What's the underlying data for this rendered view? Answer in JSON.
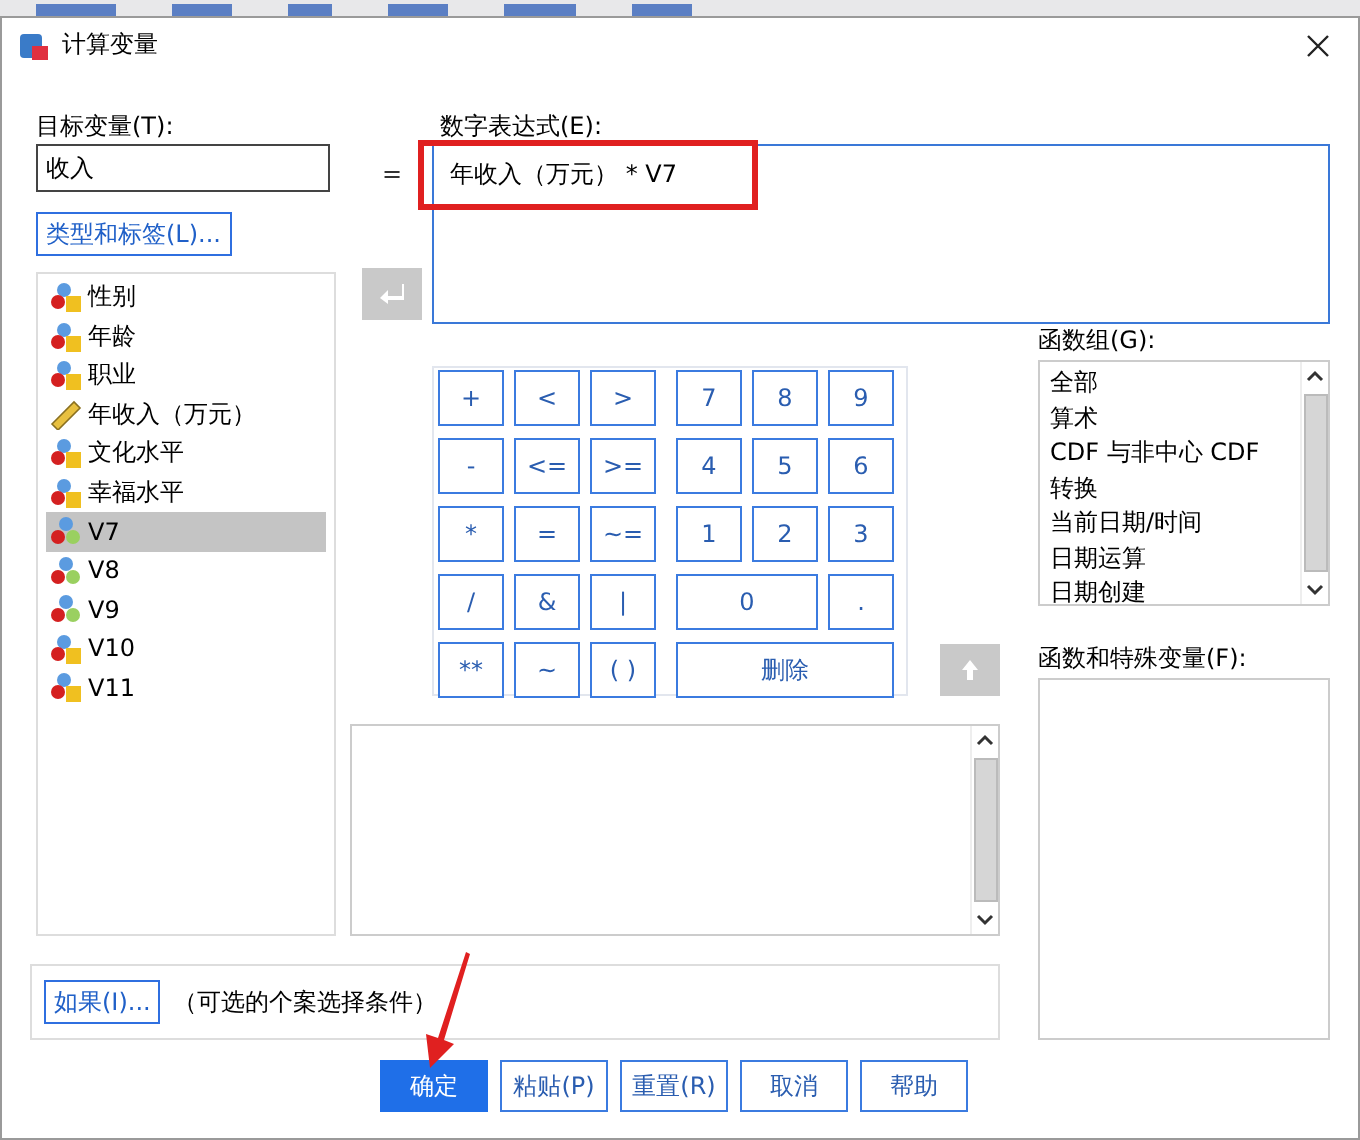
{
  "window": {
    "title": "计算变量"
  },
  "target": {
    "label": "目标变量(T):",
    "value": "收入",
    "type_button": "类型和标签(L)..."
  },
  "variables": [
    {
      "name": "性别",
      "kind": "nominal",
      "selected": false
    },
    {
      "name": "年龄",
      "kind": "nominal",
      "selected": false
    },
    {
      "name": "职业",
      "kind": "nominal",
      "selected": false
    },
    {
      "name": "年收入（万元）",
      "kind": "scale",
      "selected": false
    },
    {
      "name": "文化水平",
      "kind": "nominal",
      "selected": false
    },
    {
      "name": "幸福水平",
      "kind": "nominal",
      "selected": false
    },
    {
      "name": "V7",
      "kind": "numeric",
      "selected": true
    },
    {
      "name": "V8",
      "kind": "numeric",
      "selected": false
    },
    {
      "name": "V9",
      "kind": "numeric",
      "selected": false
    },
    {
      "name": "V10",
      "kind": "nominal",
      "selected": false
    },
    {
      "name": "V11",
      "kind": "nominal",
      "selected": false
    }
  ],
  "equals": "=",
  "expression": {
    "label": "数字表达式(E):",
    "value": "年收入（万元） * V7"
  },
  "operators": [
    {
      "label": "+"
    },
    {
      "label": "<"
    },
    {
      "label": ">"
    },
    {
      "label": "-"
    },
    {
      "label": "<="
    },
    {
      "label": ">="
    },
    {
      "label": "*"
    },
    {
      "label": "="
    },
    {
      "label": "~="
    },
    {
      "label": "/"
    },
    {
      "label": "&"
    },
    {
      "label": "|"
    },
    {
      "label": "**"
    },
    {
      "label": "~"
    },
    {
      "label": "( )"
    }
  ],
  "digits": [
    {
      "label": "7",
      "kind": "single"
    },
    {
      "label": "8",
      "kind": "single"
    },
    {
      "label": "9",
      "kind": "single"
    },
    {
      "label": "4",
      "kind": "single"
    },
    {
      "label": "5",
      "kind": "single"
    },
    {
      "label": "6",
      "kind": "single"
    },
    {
      "label": "1",
      "kind": "single"
    },
    {
      "label": "2",
      "kind": "single"
    },
    {
      "label": "3",
      "kind": "single"
    },
    {
      "label": "0",
      "kind": "double"
    },
    {
      "label": ".",
      "kind": "single"
    },
    {
      "label": "删除",
      "kind": "triple"
    }
  ],
  "function_groups": {
    "label": "函数组(G):",
    "items": [
      {
        "name": "全部",
        "selected": false
      },
      {
        "name": "算术",
        "selected": false
      },
      {
        "name": "CDF 与非中心 CDF",
        "selected": false
      },
      {
        "name": "转换",
        "selected": false
      },
      {
        "name": "当前日期/时间",
        "selected": false
      },
      {
        "name": "日期运算",
        "selected": false
      },
      {
        "name": "日期创建",
        "selected": false
      }
    ]
  },
  "functions": {
    "label": "函数和特殊变量(F):"
  },
  "condition": {
    "button": "如果(I)...",
    "note": "（可选的个案选择条件）"
  },
  "buttons": [
    {
      "label": "确定",
      "selected": true
    },
    {
      "label": "粘贴(P)",
      "selected": false
    },
    {
      "label": "重置(R)",
      "selected": false
    },
    {
      "label": "取消",
      "selected": false
    },
    {
      "label": "帮助",
      "selected": false
    }
  ]
}
